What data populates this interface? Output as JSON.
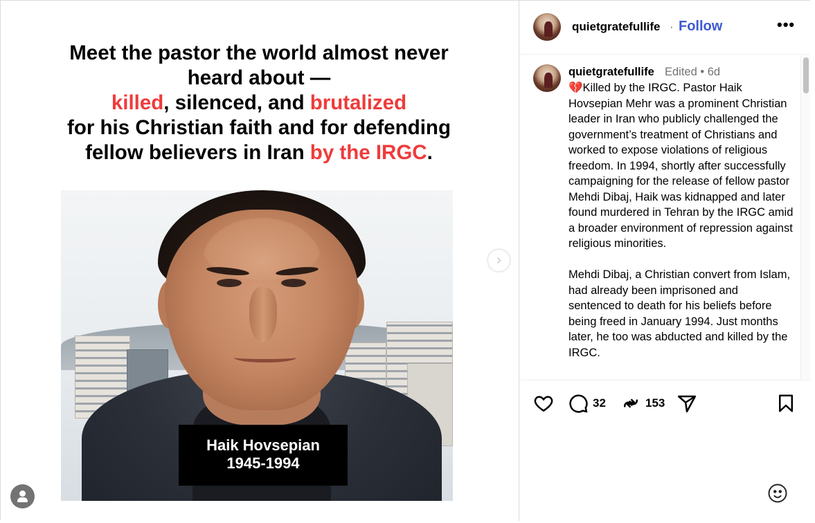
{
  "headline": {
    "line1": "Meet the pastor the world almost never",
    "line2": "heard about —",
    "line3_red1": "killed",
    "line3_mid": ", silenced, and ",
    "line3_red2": "brutalized",
    "line4": "for his Christian faith and for defending",
    "line5_start": "fellow believers in Iran ",
    "line5_red": "by the IRGC",
    "line5_end": ".",
    "accent_color": "#ef3b3b"
  },
  "photo_caption": {
    "name": "Haik Hovsepian",
    "years": "1945-1994"
  },
  "post_header": {
    "username": "quietgratefullife",
    "separator": "·",
    "follow_label": "Follow",
    "more_label": "•••"
  },
  "caption": {
    "username": "quietgratefullife",
    "meta": "Edited • 6d",
    "text": "💔Killed by the IRGC. Pastor Haik Hovsepian Mehr was a prominent Christian leader in Iran who publicly challenged the government’s treatment of Christians and worked to expose violations of religious freedom. In 1994, shortly after successfully campaigning for the release of fellow pastor Mehdi Dibaj, Haik was kidnapped and later found murdered in Tehran by the IRGC amid a broader environment of repression against religious minorities.\n\nMehdi Dibaj, a Christian convert from Islam, had already been imprisoned and sentenced to death for his beliefs before being freed in January 1994. Just months later, he too was abducted and killed by the IRGC."
  },
  "actions": {
    "comments_count": "32",
    "reposts_count": "153"
  },
  "icons": {
    "like": "heart-icon",
    "comment": "comment-icon",
    "repost": "repost-icon",
    "share": "share-icon",
    "save": "bookmark-icon",
    "emoji": "emoji-icon",
    "next": "chevron-right-icon",
    "profile": "user-icon"
  },
  "colors": {
    "follow": "#3b5ad1",
    "muted": "#737373"
  }
}
